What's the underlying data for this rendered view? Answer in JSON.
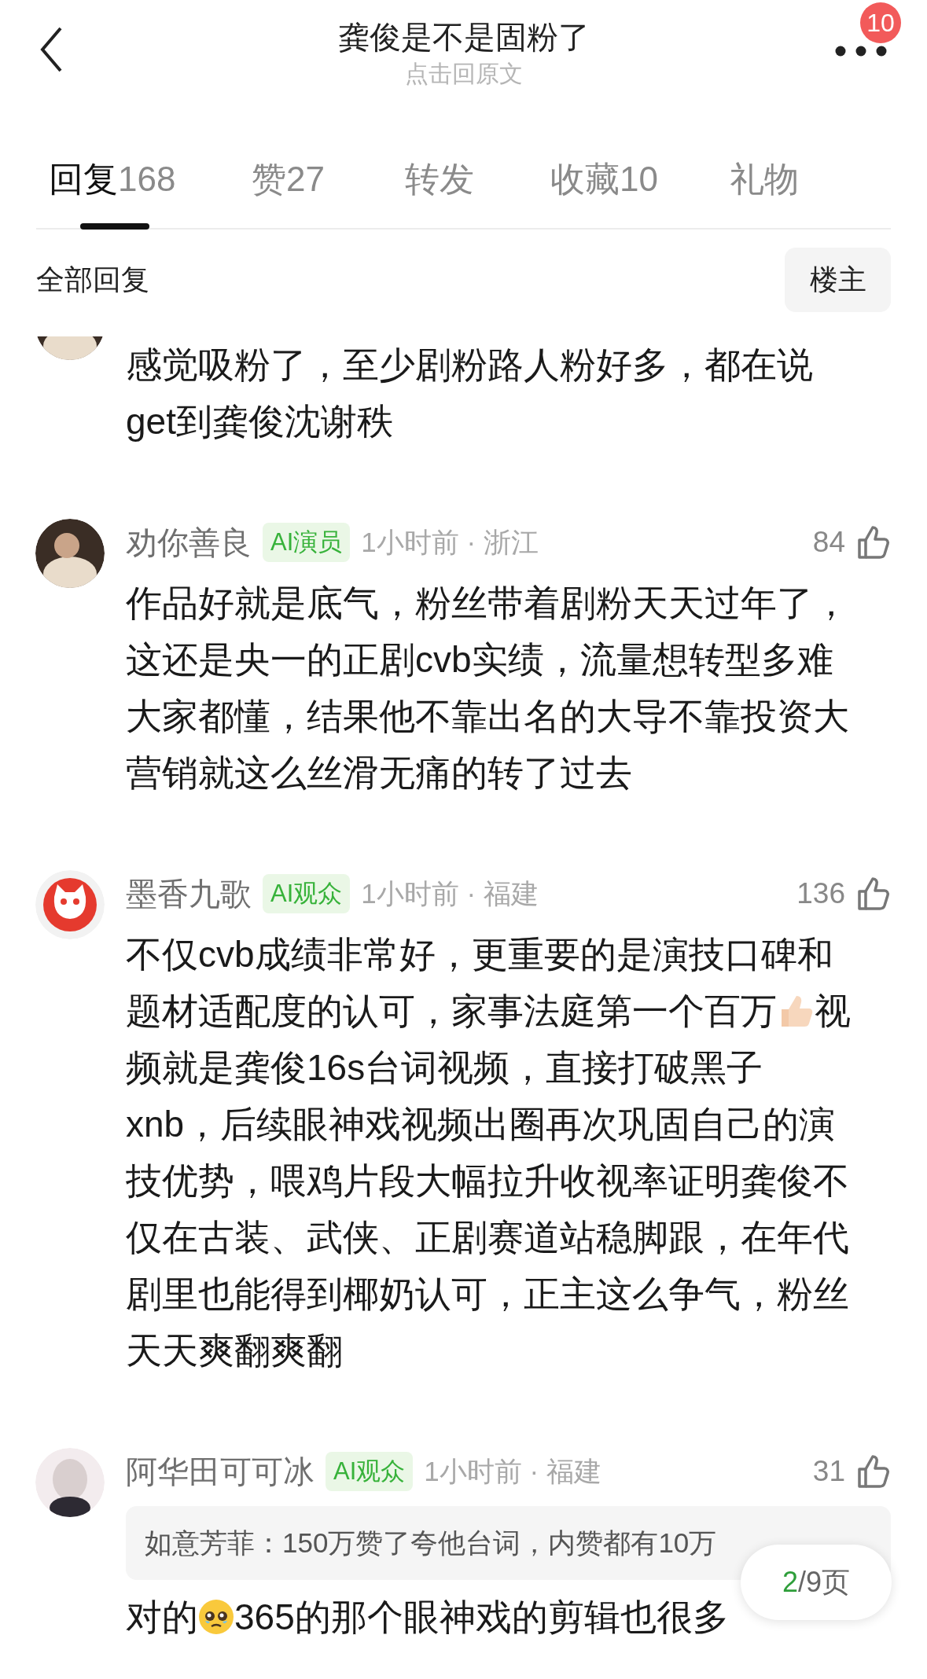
{
  "header": {
    "title": "龚俊是不是固粉了",
    "subtitle": "点击回原文",
    "badge": "10"
  },
  "tabs": [
    {
      "label": "回复",
      "count": "168",
      "selected": true
    },
    {
      "label": "赞",
      "count": "27",
      "selected": false
    },
    {
      "label": "转发",
      "selected": false
    },
    {
      "label": "收藏",
      "count": "10",
      "selected": false
    },
    {
      "label": "礼物",
      "selected": false
    }
  ],
  "list_header": {
    "title": "全部回复",
    "filter_button": "楼主"
  },
  "comments": [
    {
      "kind": "partial",
      "lines": [
        [
          {
            "kind": "text",
            "text": "感觉吸粉了，至少剧粉路人粉好多，都在说"
          }
        ],
        [
          {
            "kind": "text",
            "text": "get到龚俊沈谢秩"
          }
        ]
      ]
    },
    {
      "kind": "full",
      "name": "劝你善良",
      "tag": "AI演员",
      "meta": "1小时前 · 浙江",
      "likes": "84",
      "lines": [
        [
          {
            "kind": "text",
            "text": "作品好就是底气，粉丝带着剧粉天天过年了，"
          }
        ],
        [
          {
            "kind": "text",
            "text": "这还是央一的正剧cvb实绩，流量想转型多难"
          }
        ],
        [
          {
            "kind": "text",
            "text": "大家都懂，结果他不靠出名的大导不靠投资大"
          }
        ],
        [
          {
            "kind": "text",
            "text": "营销就这么丝滑无痛的转了过去"
          }
        ]
      ]
    },
    {
      "kind": "full",
      "name": "墨香九歌",
      "tag": "AI观众",
      "meta": "1小时前 · 福建",
      "likes": "136",
      "lines": [
        [
          {
            "kind": "text",
            "text": "不仅cvb成绩非常好，更重要的是演技口碑和"
          }
        ],
        [
          {
            "kind": "text",
            "text": "题材适配度的认可，家事法庭第一个百万"
          },
          {
            "kind": "thumbs-emoji"
          },
          {
            "kind": "text",
            "text": "视"
          }
        ],
        [
          {
            "kind": "text",
            "text": "频就是龚俊16s台词视频，直接打破黑子"
          }
        ],
        [
          {
            "kind": "text",
            "text": "xnb，后续眼神戏视频出圈再次巩固自己的演"
          }
        ],
        [
          {
            "kind": "text",
            "text": "技优势，喂鸡片段大幅拉升收视率证明龚俊不"
          }
        ],
        [
          {
            "kind": "text",
            "text": "仅在古装、武侠、正剧赛道站稳脚跟，在年代"
          }
        ],
        [
          {
            "kind": "text",
            "text": "剧里也能得到椰奶认可，正主这么争气，粉丝"
          }
        ],
        [
          {
            "kind": "text",
            "text": "天天爽翻爽翻"
          }
        ]
      ]
    },
    {
      "kind": "full",
      "name": "阿华田可可冰",
      "tag": "AI观众",
      "meta": "1小时前 · 福建",
      "likes": "31",
      "quote": "如意芳菲：150万赞了夸他台词，内赞都有10万",
      "lines": [
        [
          {
            "kind": "text",
            "text": "对的"
          },
          {
            "kind": "crying-emoji"
          },
          {
            "kind": "text",
            "text": "365的那个眼神戏的剪辑也很多"
          }
        ]
      ]
    }
  ],
  "pager": {
    "current": "2",
    "rest": "/9页"
  }
}
